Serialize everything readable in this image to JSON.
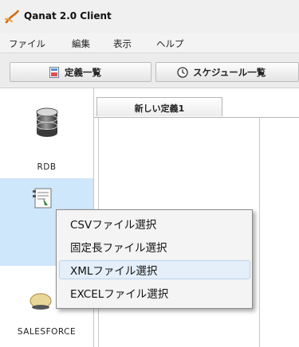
{
  "app": {
    "title": "Qanat 2.0 Client",
    "logo_icon": "qanat-logo-icon"
  },
  "menu": [
    "ファイル",
    "編集",
    "表示",
    "ヘルプ"
  ],
  "toolbar": {
    "definitions_label": "定義一覧",
    "schedule_label": "スケジュール一覧"
  },
  "sidebar": {
    "items": [
      {
        "label": "RDB",
        "icon": "database-icon"
      },
      {
        "label": "",
        "icon": "file-icon"
      },
      {
        "label": "",
        "icon": "globe-icon"
      },
      {
        "label": "SALESFORCE",
        "icon": "salesforce-icon"
      }
    ]
  },
  "tabs": {
    "active": "新しい定義1"
  },
  "context_menu": {
    "items": [
      "CSVファイル選択",
      "固定長ファイル選択",
      "XMLファイル選択",
      "EXCELファイル選択"
    ],
    "hover_index": 2
  },
  "colors": {
    "selection_bg": "#cfe7fb",
    "hover_bg": "#e5eff9",
    "hover_border": "#b9d4ee"
  }
}
